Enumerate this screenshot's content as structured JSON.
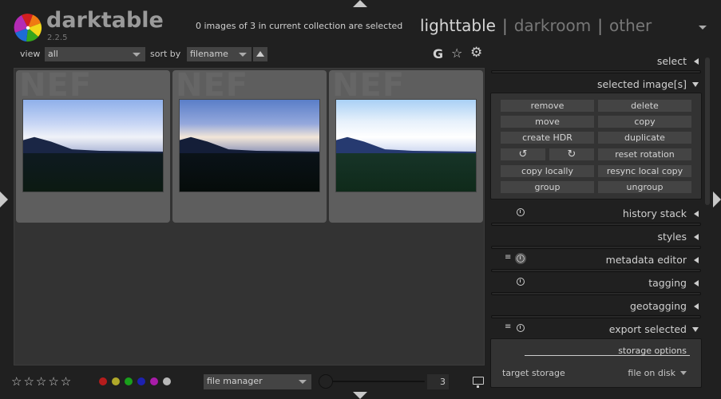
{
  "app": {
    "name": "darktable",
    "version": "2.2.5"
  },
  "header": {
    "selection_info": "0 images of 3 in current collection are selected",
    "views": [
      {
        "label": "lighttable",
        "active": true
      },
      {
        "label": "darkroom",
        "active": false
      },
      {
        "label": "other",
        "active": false
      }
    ],
    "view_separator": "|"
  },
  "filter_bar": {
    "view_label": "view",
    "view_value": "all",
    "sort_label": "sort by",
    "sort_value": "filename",
    "tools": {
      "grouping": "G",
      "overlays_icon": "star-icon",
      "preferences_icon": "gear-icon"
    }
  },
  "thumbnails": [
    {
      "ext": "NEF",
      "variant": "bright"
    },
    {
      "ext": "NEF",
      "variant": "dark"
    },
    {
      "ext": "NEF",
      "variant": "overexposed"
    }
  ],
  "right_panel": {
    "modules": [
      {
        "title": "select",
        "expanded": false
      },
      {
        "title": "selected image[s]",
        "expanded": true
      },
      {
        "title": "history stack",
        "expanded": false,
        "presets": true
      },
      {
        "title": "styles",
        "expanded": false
      },
      {
        "title": "metadata editor",
        "expanded": false,
        "presets": true,
        "menu": true
      },
      {
        "title": "tagging",
        "expanded": false,
        "presets": true
      },
      {
        "title": "geotagging",
        "expanded": false
      },
      {
        "title": "export selected",
        "expanded": true,
        "presets": true,
        "menu": true
      }
    ],
    "selected_images_buttons": {
      "remove": "remove",
      "delete": "delete",
      "move": "move",
      "copy": "copy",
      "create_hdr": "create HDR",
      "duplicate": "duplicate",
      "rotate_ccw_icon": "↺",
      "rotate_cw_icon": "↻",
      "reset_rotation": "reset rotation",
      "copy_locally": "copy locally",
      "resync_local_copy": "resync local copy",
      "group": "group",
      "ungroup": "ungroup"
    },
    "export": {
      "storage_options": "storage options",
      "target_storage_label": "target storage",
      "target_storage_value": "file on disk"
    },
    "menu_glyph": "≡"
  },
  "bottom_bar": {
    "stars": "☆☆☆☆☆",
    "color_labels": [
      {
        "name": "red",
        "color": "#b51c1c"
      },
      {
        "name": "yellow",
        "color": "#b0a82a"
      },
      {
        "name": "green",
        "color": "#19a01b"
      },
      {
        "name": "blue",
        "color": "#1d21b0"
      },
      {
        "name": "purple",
        "color": "#a81ca8"
      },
      {
        "name": "gray",
        "color": "#b8b8b8"
      }
    ],
    "layout_value": "file manager",
    "zoom_value": "3"
  }
}
